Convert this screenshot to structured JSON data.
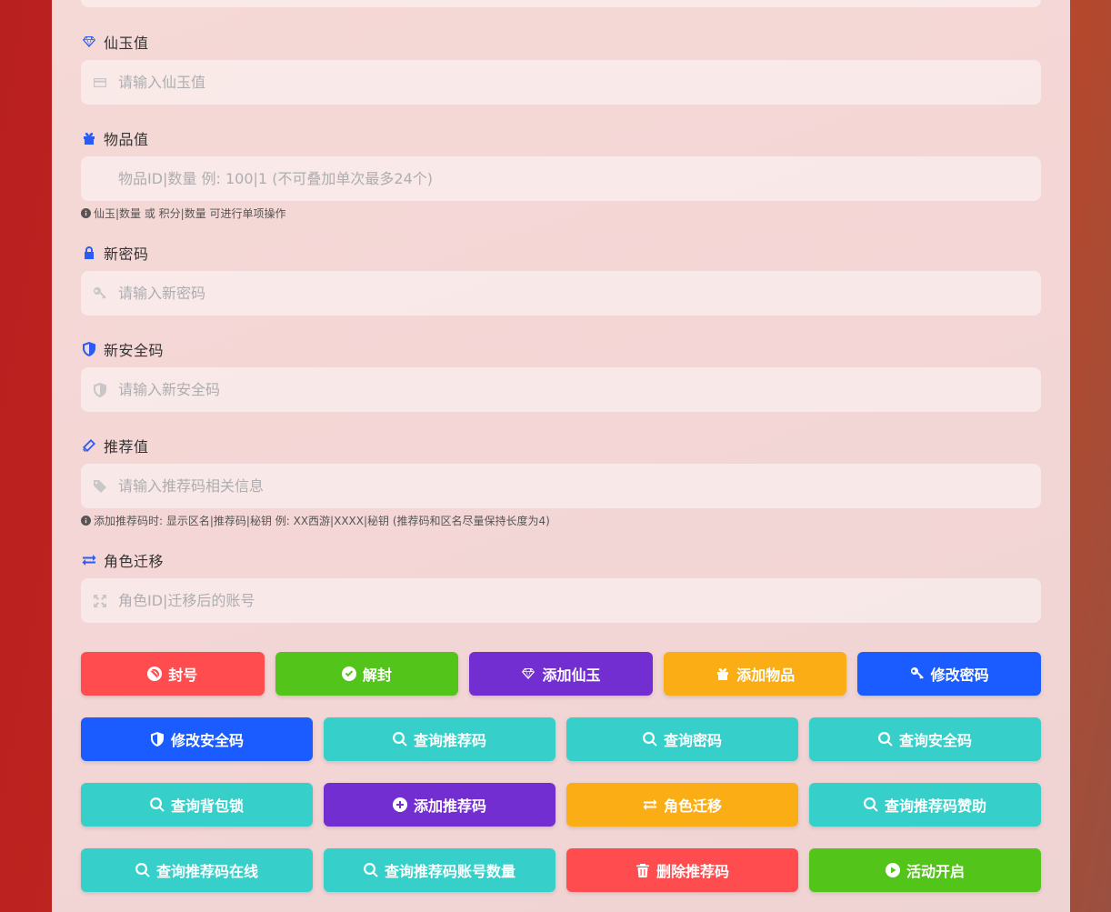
{
  "fields": [
    {
      "label": "仙玉值",
      "label_icon": "gem-icon",
      "input_icon": "credit-card-icon",
      "placeholder": "请输入仙玉值",
      "value": ""
    },
    {
      "label": "物品值",
      "label_icon": "gift-icon",
      "input_icon": "",
      "placeholder": "物品ID|数量 例: 100|1 (不可叠加单次最多24个)",
      "value": "",
      "hint": "仙玉|数量 或 积分|数量 可进行单项操作"
    },
    {
      "label": "新密码",
      "label_icon": "lock-icon",
      "input_icon": "key-icon",
      "placeholder": "请输入新密码",
      "value": ""
    },
    {
      "label": "新安全码",
      "label_icon": "shield-icon",
      "input_icon": "shield-icon",
      "placeholder": "请输入新安全码",
      "value": ""
    },
    {
      "label": "推荐值",
      "label_icon": "ticket-icon",
      "input_icon": "tag-icon",
      "placeholder": "请输入推荐码相关信息",
      "value": "",
      "hint": "添加推荐码时: 显示区名|推荐码|秘钥 例: XX西游|XXXX|秘钥 (推荐码和区名尽量保持长度为4)"
    },
    {
      "label": "角色迁移",
      "label_icon": "exchange-icon",
      "input_icon": "expand-icon",
      "placeholder": "角色ID|迁移后的账号",
      "value": ""
    }
  ],
  "buttons": {
    "row1": [
      {
        "label": "封号",
        "icon": "ban-icon",
        "color": "#ff4d4f"
      },
      {
        "label": "解封",
        "icon": "check-circle-icon",
        "color": "#52c41a"
      },
      {
        "label": "添加仙玉",
        "icon": "gem-icon",
        "color": "#722ed1"
      },
      {
        "label": "添加物品",
        "icon": "gift-icon",
        "color": "#faad14"
      },
      {
        "label": "修改密码",
        "icon": "key-icon",
        "color": "#1a5cff"
      }
    ],
    "row2": [
      {
        "label": "修改安全码",
        "icon": "shield-icon",
        "color": "#1a5cff"
      },
      {
        "label": "查询推荐码",
        "icon": "search-icon",
        "color": "#36cfc9"
      },
      {
        "label": "查询密码",
        "icon": "search-icon",
        "color": "#36cfc9"
      },
      {
        "label": "查询安全码",
        "icon": "search-icon",
        "color": "#36cfc9"
      }
    ],
    "row3": [
      {
        "label": "查询背包锁",
        "icon": "search-icon",
        "color": "#36cfc9"
      },
      {
        "label": "添加推荐码",
        "icon": "plus-circle-icon",
        "color": "#722ed1"
      },
      {
        "label": "角色迁移",
        "icon": "exchange-icon",
        "color": "#faad14"
      },
      {
        "label": "查询推荐码赞助",
        "icon": "search-icon",
        "color": "#36cfc9"
      }
    ],
    "row4": [
      {
        "label": "查询推荐码在线",
        "icon": "search-icon",
        "color": "#36cfc9"
      },
      {
        "label": "查询推荐码账号数量",
        "icon": "search-icon",
        "color": "#36cfc9"
      },
      {
        "label": "删除推荐码",
        "icon": "trash-icon",
        "color": "#ff4d4f"
      },
      {
        "label": "活动开启",
        "icon": "play-circle-icon",
        "color": "#52c41a"
      }
    ]
  },
  "colors": {
    "accent": "#2a5bf2",
    "placeholder": "#aeadb0"
  }
}
